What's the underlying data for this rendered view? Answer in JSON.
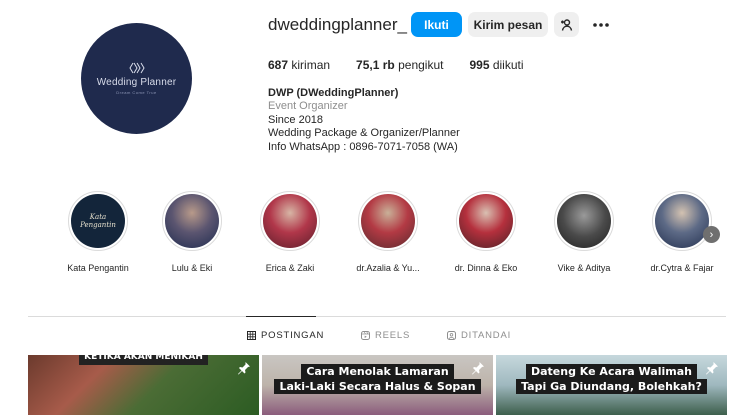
{
  "profile": {
    "username": "dweddingplanner_",
    "avatar_brand": "Wedding Planner",
    "avatar_tagline": "Dream Come True"
  },
  "actions": {
    "follow_label": "Ikuti",
    "message_label": "Kirim pesan"
  },
  "stats": {
    "posts_value": "687",
    "posts_label": "kiriman",
    "followers_value": "75,1 rb",
    "followers_label": "pengikut",
    "following_value": "995",
    "following_label": "diikuti"
  },
  "bio": {
    "name": "DWP (DWeddingPlanner)",
    "category": "Event Organizer",
    "lines": [
      "Since 2018",
      "Wedding Package & Organizer/Planner",
      "Info WhatsApp : 0896-7071-7058 (WA)"
    ]
  },
  "highlights": [
    {
      "label": "Kata Pengantin",
      "cover_text": "Kata Pengantin"
    },
    {
      "label": "Lulu & Eki"
    },
    {
      "label": "Erica & Zaki"
    },
    {
      "label": "dr.Azalia & Yu..."
    },
    {
      "label": "dr. Dinna & Eko"
    },
    {
      "label": "Vike & Aditya"
    },
    {
      "label": "dr.Cytra & Fajar"
    }
  ],
  "tabs": [
    {
      "label": "POSTINGAN",
      "icon": "grid-icon",
      "active": true
    },
    {
      "label": "REELS",
      "icon": "reels-icon",
      "active": false
    },
    {
      "label": "DITANDAI",
      "icon": "tagged-icon",
      "active": false
    }
  ],
  "posts": [
    {
      "caption_lines": [
        "KETIKA AKAN MENIKAH"
      ]
    },
    {
      "caption_lines": [
        "Cara Menolak Lamaran",
        "Laki-Laki Secara Halus & Sopan"
      ]
    },
    {
      "caption_lines": [
        "Dateng Ke Acara Walimah",
        "Tapi Ga Diundang, Bolehkah?"
      ]
    }
  ],
  "colors": {
    "accent": "#0095f6",
    "avatar_bg": "#1f2a4d"
  }
}
